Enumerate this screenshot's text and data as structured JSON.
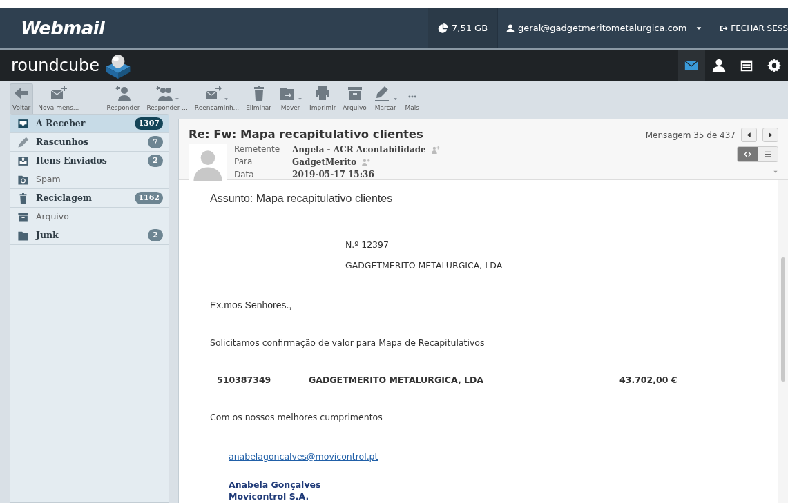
{
  "topbar": {
    "brand": "Webmail",
    "quota": "7,51 GB",
    "account": "geral@gadgetmeritometalurgica.com",
    "logout": "FECHAR SESS"
  },
  "navbar": {
    "logo": "roundcube",
    "apps": [
      {
        "kind": "mail",
        "selected": true
      },
      {
        "kind": "contacts",
        "selected": false
      },
      {
        "kind": "calendar",
        "selected": false
      },
      {
        "kind": "settings",
        "selected": false
      }
    ]
  },
  "toolbar": [
    {
      "kind": "back",
      "label": "Voltar",
      "pressed": true,
      "caret": false
    },
    {
      "kind": "compose",
      "label": "Nova mens...",
      "pressed": false,
      "caret": false
    },
    {
      "kind": "reply",
      "label": "Responder",
      "pressed": false,
      "caret": false
    },
    {
      "kind": "reply-all",
      "label": "Responder ...",
      "pressed": false,
      "caret": true
    },
    {
      "kind": "forward",
      "label": "Reencaminh...",
      "pressed": false,
      "caret": true
    },
    {
      "kind": "delete",
      "label": "Eliminar",
      "pressed": false,
      "caret": false
    },
    {
      "kind": "move",
      "label": "Mover",
      "pressed": false,
      "caret": true
    },
    {
      "kind": "print",
      "label": "Imprimir",
      "pressed": false,
      "caret": false
    },
    {
      "kind": "archive",
      "label": "Arquivo",
      "pressed": false,
      "caret": false
    },
    {
      "kind": "mark",
      "label": "Marcar",
      "pressed": false,
      "caret": true
    },
    {
      "kind": "more",
      "label": "Mais",
      "pressed": false,
      "caret": false
    }
  ],
  "folders": [
    {
      "kind": "inbox",
      "name": "A Receber",
      "count": "1307",
      "selected": true
    },
    {
      "kind": "drafts",
      "name": "Rascunhos",
      "count": "7",
      "selected": false
    },
    {
      "kind": "sent",
      "name": "Itens Enviados",
      "count": "2",
      "selected": false
    },
    {
      "kind": "spam",
      "name": "Spam",
      "selected": false
    },
    {
      "kind": "trash",
      "name": "Reciclagem",
      "count": "1162",
      "selected": false
    },
    {
      "kind": "archive",
      "name": "Arquivo",
      "selected": false
    },
    {
      "kind": "folder",
      "name": "Junk",
      "count": "2",
      "selected": false
    }
  ],
  "message": {
    "subject": "Re: Fw: Mapa recapitulativo clientes",
    "position": "Mensagem 35 de 437",
    "headers": [
      {
        "label": "Remetente",
        "value": "Angela - ACR Acontabilidade",
        "add_contact": true
      },
      {
        "label": "Para",
        "value": "GadgetMerito",
        "add_contact": true
      },
      {
        "label": "Data",
        "value": "2019-05-17 15:36",
        "add_contact": false
      }
    ],
    "view_modes": [
      {
        "kind": "html",
        "selected": true
      },
      {
        "kind": "plain",
        "selected": false
      }
    ],
    "body": [
      {
        "kind": "heading",
        "text": "Assunto: Mapa recapitulativo clientes"
      },
      {
        "kind": "indented",
        "text": "N.º 12397"
      },
      {
        "kind": "indented",
        "text": "GADGETMERITO METALURGICA, LDA"
      },
      {
        "kind": "arial",
        "text": "Ex.mos Senhores.,"
      },
      {
        "kind": "plain",
        "text": "Solicitamos confirmação de valor para Mapa de Recapitulativos"
      },
      {
        "kind": "row",
        "cells": [
          "510387349",
          "GADGETMERITO METALURGICA, LDA",
          "43.702,00 €"
        ]
      },
      {
        "kind": "plain",
        "text": "Com os nossos melhores cumprimentos"
      },
      {
        "kind": "link",
        "text": "anabelagoncalves@movicontrol.pt"
      },
      {
        "kind": "signature",
        "lines": [
          "Anabela Gonçalves",
          "Movicontrol S.A."
        ]
      }
    ]
  }
}
